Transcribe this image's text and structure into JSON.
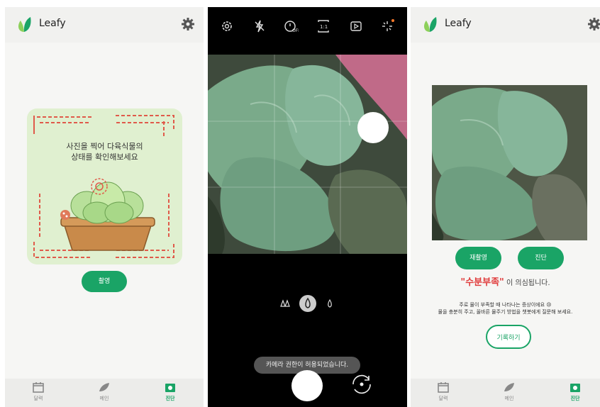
{
  "app": {
    "name": "Leafy"
  },
  "nav": {
    "calendar": "달력",
    "home": "메인",
    "diagnose": "진단"
  },
  "diagnose_screen": {
    "prompt_line1": "사진을 찍어 다육식물의",
    "prompt_line2": "상태를 확인해보세요",
    "shoot_button": "촬영"
  },
  "camera": {
    "toast": "카메라 권한이 허용되었습니다.",
    "icons": [
      "settings-icon",
      "flash-off-icon",
      "timer-off-icon",
      "ratio-icon",
      "motion-photo-icon",
      "filter-icon"
    ]
  },
  "result_screen": {
    "retake_button": "재촬영",
    "diagnose_button": "진단",
    "result_highlight": "\"수분부족\"",
    "result_suffix": " 이 의심됩니다.",
    "advice_line1": "주로 물이 부족할 때 나타나는 증상이에요 😢",
    "advice_line2": "물을 충분히 주고, 올바른 물주기 방법을 챗봇에게 질문해 보세요.",
    "record_button": "기록하기"
  },
  "colors": {
    "brand": "#1aa466",
    "alert": "#e03a3a",
    "card": "#e0f0d0"
  }
}
